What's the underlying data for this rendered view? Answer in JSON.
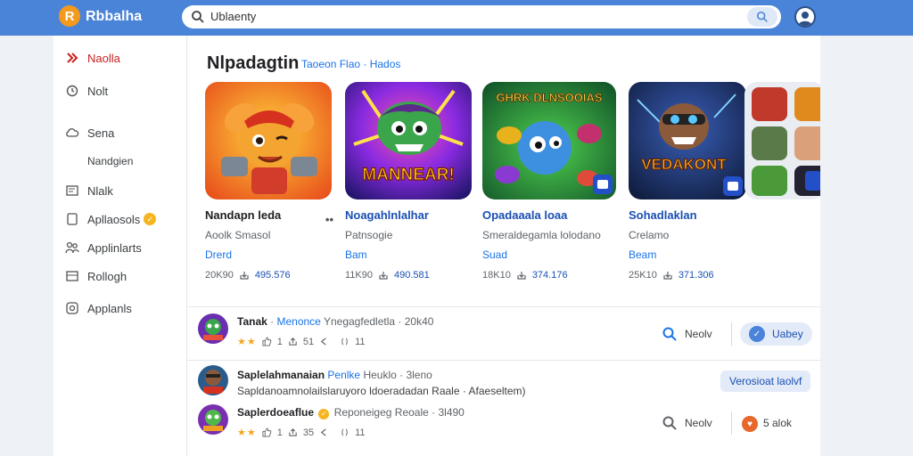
{
  "app": {
    "logo_glyph": "R",
    "name": "Rbbalha"
  },
  "search": {
    "value": "Ublaenty"
  },
  "sidebar": {
    "items": [
      {
        "label": "Naolla",
        "icon": "logo-icon"
      },
      {
        "label": "Nolt",
        "icon": "clock-icon"
      },
      {
        "label": "Sena",
        "icon": "cloud-icon"
      },
      {
        "label": "Nandgien",
        "icon": ""
      },
      {
        "label": "Nlalk",
        "icon": "window-icon"
      },
      {
        "label": "Apllaosols",
        "icon": "tablet-icon"
      },
      {
        "label": "Applinlarts",
        "icon": "people-icon"
      },
      {
        "label": "Rollogh",
        "icon": "list-icon"
      },
      {
        "label": "Applanls",
        "icon": "camera-icon"
      }
    ]
  },
  "section": {
    "title": "Nlpadagtin",
    "subtitle": "Taoeon Flao · Hados"
  },
  "cards": [
    {
      "title": "Nandapn leda",
      "sub": "Aoolk Smasol",
      "tag": "Drerd",
      "size": "20K90",
      "downloads": "495.576"
    },
    {
      "title": "Noagahlnlalhar",
      "sub": "Patnsogie",
      "tag": "Bam",
      "size": "11K90",
      "downloads": "490.581"
    },
    {
      "title": "Opadaaala loaa",
      "sub": "Smeraldegamla lolodano",
      "tag": "Suad",
      "size": "18K10",
      "downloads": "374.176"
    },
    {
      "title": "Sohadlaklan",
      "sub": "Crelamo",
      "tag": "Beam",
      "size": "25K10",
      "downloads": "371.306"
    }
  ],
  "art": {
    "card1": "",
    "card2": "MANNEAR!",
    "card3": "GHRK DLNSOOIAS",
    "card4": "VEDAKONT"
  },
  "rows": [
    {
      "name": "Tanak",
      "tag": "Menonce",
      "meta": "Ynegagfedletla · 20k40",
      "stars": "★★",
      "likes": "1",
      "shares": "51",
      "comments": "",
      "count": "11",
      "action1": "Neolv",
      "pill": "Uabey"
    },
    {
      "name": "Saplelahmanaian",
      "tag": "Penlke",
      "meta": "Heuklo · 3leno",
      "line2": "Sapldanoamnolailslaruyoro ldoeradadan Raale · Afaeseltem)",
      "pill": "Verosioat laolvf"
    },
    {
      "name": "Saplerdoeaflue",
      "tag": "Reponeigeg",
      "meta": "Reoale · 3l490",
      "stars": "★★",
      "likes": "1",
      "shares": "35",
      "comments": "",
      "count": "11",
      "action1": "Neolv",
      "action2": "5 alok"
    }
  ],
  "colors": {
    "accent": "#4a84d8",
    "active": "#c5221f",
    "star": "#f5a623"
  }
}
